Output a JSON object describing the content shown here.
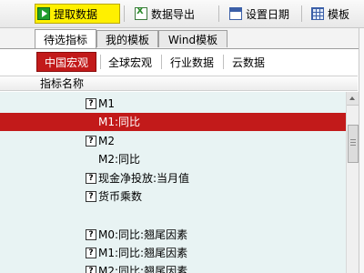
{
  "toolbar": {
    "buttons": [
      {
        "label": "提取数据",
        "icon": "play-icon"
      },
      {
        "label": "数据导出",
        "icon": "excel-export-icon"
      },
      {
        "label": "设置日期",
        "icon": "calendar-icon"
      },
      {
        "label": "模板",
        "icon": "template-grid-icon"
      }
    ],
    "accent": "#fff000"
  },
  "tabs": [
    "待选指标",
    "我的模板",
    "Wind模板"
  ],
  "active_tab": "待选指标",
  "subtabs": [
    "中国宏观",
    "全球宏观",
    "行业数据",
    "云数据"
  ],
  "active_subtab": "中国宏观",
  "selection_color": "#c21a1a",
  "list_header": "指标名称",
  "items": [
    {
      "label": "M1",
      "icon": true
    },
    {
      "label": "M1:同比",
      "icon": false,
      "selected": true
    },
    {
      "label": "M2",
      "icon": true
    },
    {
      "label": "M2:同比",
      "icon": false
    },
    {
      "label": "现金净投放:当月值",
      "icon": true
    },
    {
      "label": "货币乘数",
      "icon": true
    },
    {
      "label": "",
      "icon": false
    },
    {
      "label": "M0:同比:翘尾因素",
      "icon": true
    },
    {
      "label": "M1:同比:翘尾因素",
      "icon": true
    },
    {
      "label": "M2:同比:翘尾因素",
      "icon": true
    }
  ],
  "help_icon_glyph": "?"
}
